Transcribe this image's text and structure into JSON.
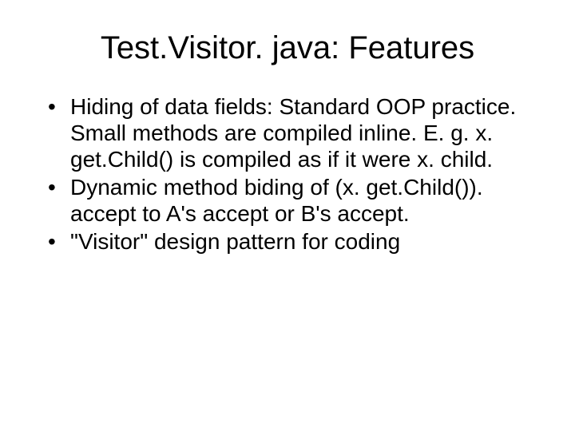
{
  "title": "Test.Visitor. java: Features",
  "bullets": [
    "Hiding of data fields: Standard OOP practice. Small methods are compiled inline.  E. g. x. get.Child() is compiled as if it were x. child.",
    "Dynamic method biding of (x. get.Child()). accept to A's accept or B's accept.",
    "\"Visitor\" design pattern for coding"
  ]
}
